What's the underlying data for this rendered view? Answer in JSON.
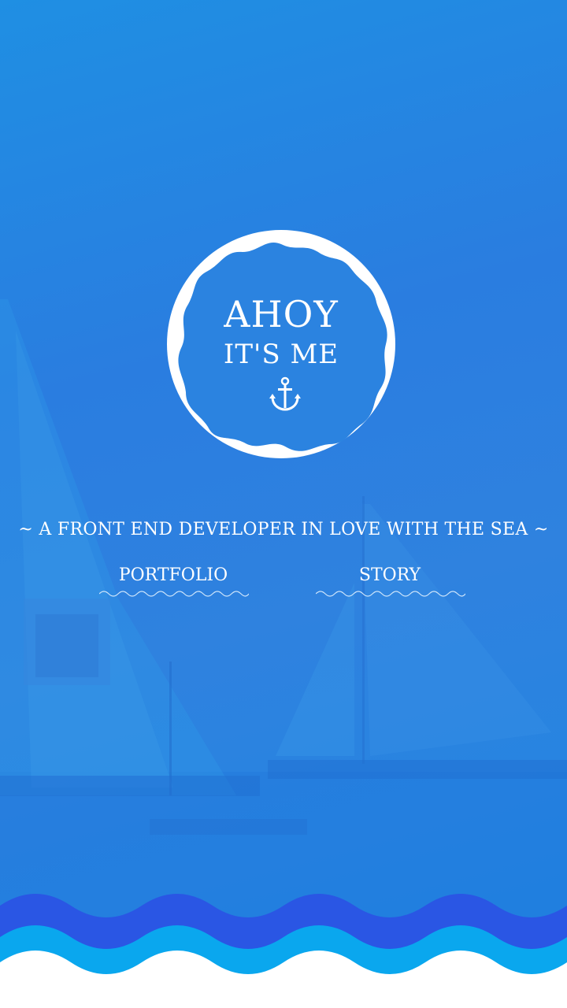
{
  "badge": {
    "line1": "AHOY",
    "line2": "IT'S ME",
    "icon": "anchor-icon"
  },
  "tagline": "~ A FRONT END DEVELOPER IN LOVE WITH THE SEA ~",
  "nav": {
    "portfolio_label": "PORTFOLIO",
    "story_label": "STORY"
  },
  "colors": {
    "background_top": "#1f8fe3",
    "background_mid": "#2a7de0",
    "wave_dark": "#2a56e4",
    "wave_light": "#0aa7ee",
    "foreground": "#ffffff"
  }
}
